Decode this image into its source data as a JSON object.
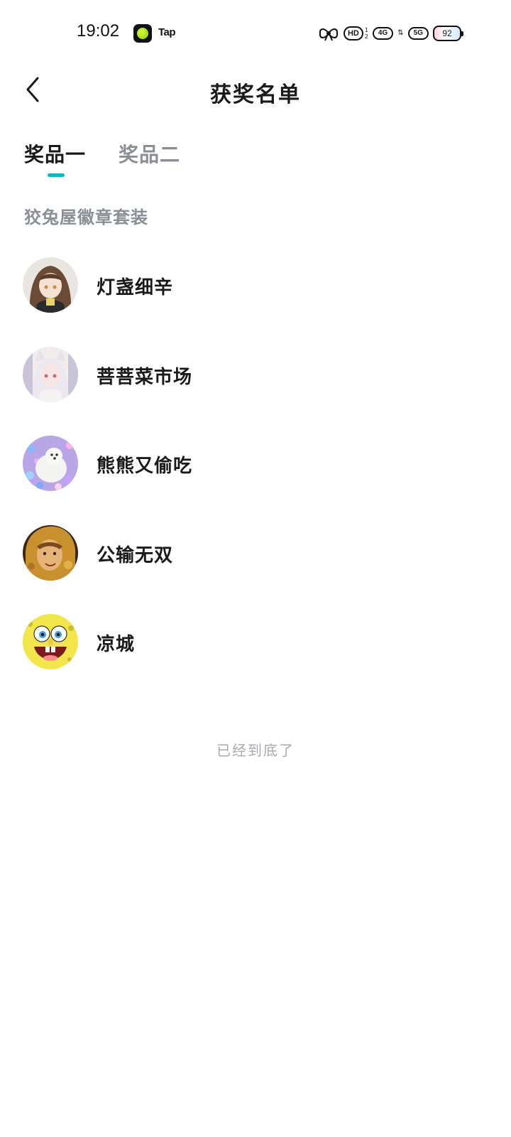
{
  "status_bar": {
    "time": "19:02",
    "app_label": "Tap",
    "hd_badge": "HD",
    "signal_sub_top": "1",
    "signal_sub_bottom": "2",
    "net_4g": "4G",
    "net_5g": "5G",
    "battery": "92"
  },
  "nav": {
    "title": "获奖名单",
    "back_icon": "chevron-left-icon"
  },
  "tabs": [
    {
      "label": "奖品一",
      "active": true
    },
    {
      "label": "奖品二",
      "active": false
    }
  ],
  "prize": {
    "name": "狡兔屋徽章套装"
  },
  "winners": [
    {
      "name": "灯盏细辛",
      "avatar": "anime-girl-avatar"
    },
    {
      "name": "菩菩菜市场",
      "avatar": "cat-ear-girl-avatar"
    },
    {
      "name": "熊熊又偷吃",
      "avatar": "white-dog-flowers-avatar"
    },
    {
      "name": "公输无双",
      "avatar": "warrior-avatar"
    },
    {
      "name": "凉城",
      "avatar": "spongebob-avatar"
    }
  ],
  "footer": {
    "end_text": "已经到底了"
  },
  "colors": {
    "accent": "#14b6c4",
    "muted_text": "#8a8f96",
    "primary_text": "#1a1a1a"
  }
}
